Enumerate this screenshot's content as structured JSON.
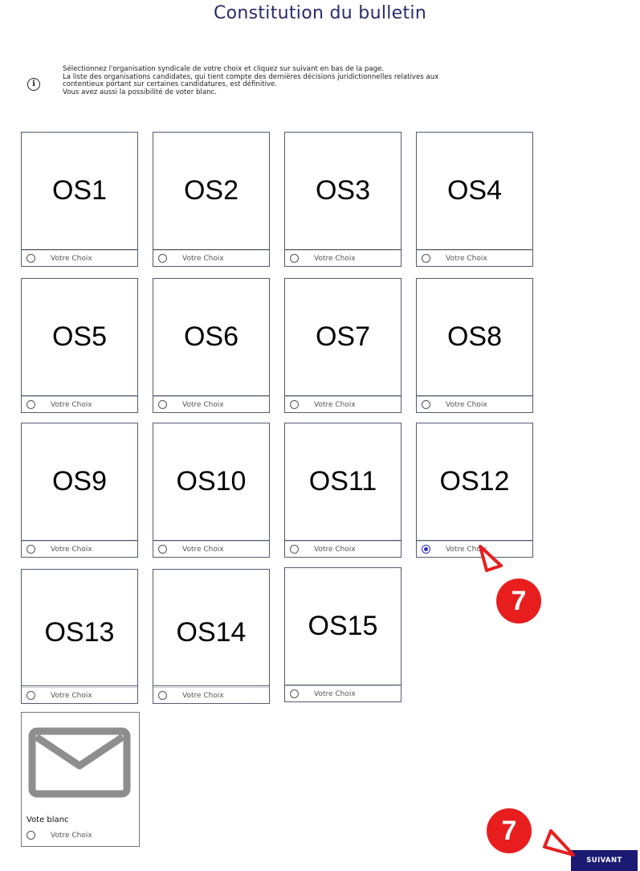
{
  "page": {
    "title": "Constitution du bulletin",
    "info_icon": "info-icon",
    "info_lines": [
      "Sélectionnez l'organisation syndicale de votre choix et cliquez sur suivant en bas de la page.",
      "La liste des organisations candidates, qui tient compte des dernières décisions juridictionnelles relatives aux",
      "contentieux portant sur certaines candidatures, est définitive.",
      "Vous avez aussi la possibilité de voter blanc."
    ]
  },
  "choice_label": "Votre Choix",
  "selected": "OS12",
  "organisations": [
    "OS1",
    "OS2",
    "OS3",
    "OS4",
    "OS5",
    "OS6",
    "OS7",
    "OS8",
    "OS9",
    "OS10",
    "OS11",
    "OS12",
    "OS13",
    "OS14",
    "OS15"
  ],
  "blank_vote": {
    "label": "Vote blanc",
    "icon": "envelope-icon"
  },
  "next_button": "SUIVANT",
  "annotations": [
    "7",
    "7"
  ],
  "colors": {
    "accent": "#1a1a73",
    "title": "#2a2a6e",
    "annotation": "#e81e1e",
    "radio_selected": "#2b2bd6"
  }
}
